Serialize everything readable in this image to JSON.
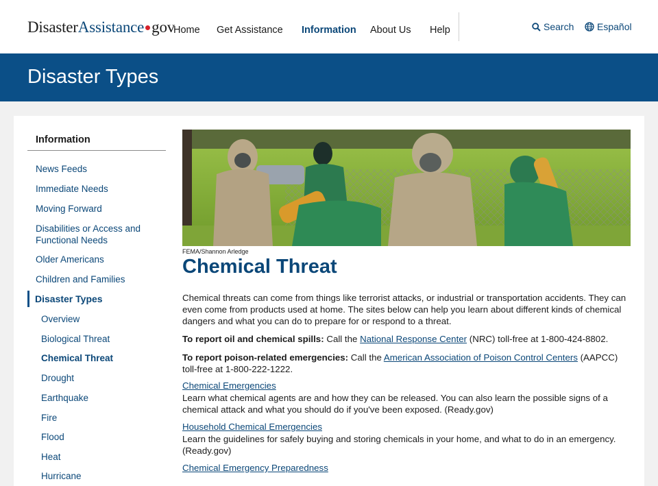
{
  "header": {
    "logo_part1": "Disaster",
    "logo_part2": "Assistance",
    "logo_part3": "gov",
    "nav": [
      "Home",
      "Get Assistance",
      "Information",
      "About Us",
      "Help"
    ],
    "active_nav": "Information",
    "search_label": "Search",
    "language_label": "Español"
  },
  "banner": {
    "title": "Disaster Types"
  },
  "sidebar": {
    "heading": "Information",
    "items": [
      "News Feeds",
      "Immediate Needs",
      "Moving Forward",
      "Disabilities or Access and Functional Needs",
      "Older Americans",
      "Children and Families",
      "Disaster Types",
      "Overview",
      "Biological Threat",
      "Chemical Threat",
      "Drought",
      "Earthquake",
      "Fire",
      "Flood",
      "Heat",
      "Hurricane"
    ],
    "current_section": "Disaster Types",
    "current_page": "Chemical Threat"
  },
  "main": {
    "photo_credit": "FEMA/Shannon Arledge",
    "title": "Chemical Threat",
    "intro": "Chemical threats can come from things like terrorist attacks, or industrial or transportation accidents. They can even come from products used at home. The sites below can help you learn about different kinds of chemical dangers and what you can do to prepare for or respond to a threat.",
    "oil": {
      "bold": "To report oil and chemical spills:",
      "pre": " Call the ",
      "link": "National Response Center",
      "post": " (NRC) toll-free at 1-800-424-8802."
    },
    "poison": {
      "bold": "To report poison-related emergencies:",
      "pre": " Call the ",
      "link": "American Association of Poison Control Centers",
      "post": " (AAPCC) toll-free at 1-800-222-1222."
    },
    "resources": [
      {
        "title": "Chemical Emergencies",
        "desc": "Learn what chemical agents are and how they can be released. You can also learn the possible signs of a chemical attack and what you should do if you've been exposed. (Ready.gov)"
      },
      {
        "title": "Household Chemical Emergencies",
        "desc": "Learn the guidelines for safely buying and storing chemicals in your home, and what to do in an emergency. (Ready.gov)"
      },
      {
        "title": "Chemical Emergency Preparedness",
        "desc": ""
      }
    ]
  }
}
